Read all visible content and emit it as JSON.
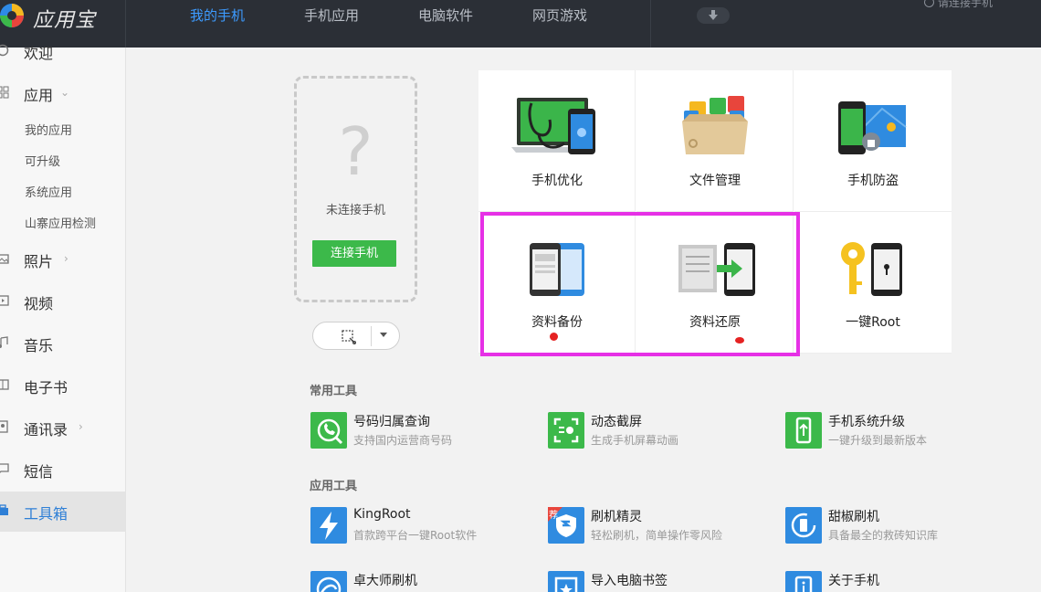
{
  "app": {
    "logo_text": "应用宝",
    "nav_tabs": [
      "我的手机",
      "手机应用",
      "电脑软件",
      "网页游戏"
    ],
    "active_tab": "我的手机",
    "top_connect_text": "请连接手机"
  },
  "sidebar": {
    "items": [
      {
        "label": "欢迎",
        "icon": "welcome-icon"
      },
      {
        "label": "应用",
        "icon": "grid-icon"
      },
      {
        "label": "照片",
        "icon": "photo-icon"
      },
      {
        "label": "视频",
        "icon": "video-icon"
      },
      {
        "label": "音乐",
        "icon": "music-icon"
      },
      {
        "label": "电子书",
        "icon": "book-icon"
      },
      {
        "label": "通讯录",
        "icon": "contacts-icon"
      },
      {
        "label": "短信",
        "icon": "sms-icon"
      },
      {
        "label": "工具箱",
        "icon": "toolbox-icon"
      }
    ],
    "sub_items": [
      "我的应用",
      "可升级",
      "系统应用",
      "山寨应用检测"
    ],
    "active": "工具箱"
  },
  "device": {
    "status": "未连接手机",
    "connect_label": "连接手机",
    "question_mark": "?"
  },
  "grid_tools": [
    {
      "label": "手机优化",
      "icon": "stethoscope-laptop-icon"
    },
    {
      "label": "文件管理",
      "icon": "file-box-icon"
    },
    {
      "label": "手机防盗",
      "icon": "phone-lock-icon"
    },
    {
      "label": "资料备份",
      "icon": "backup-phones-icon"
    },
    {
      "label": "资料还原",
      "icon": "restore-doc-icon"
    },
    {
      "label": "一键Root",
      "icon": "key-phone-icon"
    }
  ],
  "sections": {
    "common_title": "常用工具",
    "app_title": "应用工具"
  },
  "common_tools": [
    {
      "name": "号码归属查询",
      "desc": "支持国内运营商号码",
      "color": "#3cb94a"
    },
    {
      "name": "动态截屏",
      "desc": "生成手机屏幕动画",
      "color": "#3cb94a"
    },
    {
      "name": "手机系统升级",
      "desc": "一键升级到最新版本",
      "color": "#3cb94a"
    }
  ],
  "app_tools": [
    {
      "name": "KingRoot",
      "desc": "首款跨平台一键Root软件",
      "color": "#2f8be0"
    },
    {
      "name": "刷机精灵",
      "desc": "轻松刷机，简单操作零风险",
      "color": "#2f8be0",
      "badge": "荐"
    },
    {
      "name": "甜椒刷机",
      "desc": "具备最全的救砖知识库",
      "color": "#2f8be0"
    },
    {
      "name": "卓大师刷机",
      "desc": "",
      "color": "#2f8be0"
    },
    {
      "name": "导入电脑书签",
      "desc": "",
      "color": "#2f8be0"
    },
    {
      "name": "关于手机",
      "desc": "",
      "color": "#2f8be0"
    }
  ],
  "colors": {
    "accent": "#3d9bff",
    "green": "#3cb94a",
    "highlight": "#e630e6",
    "topbar": "#2b2f36"
  }
}
